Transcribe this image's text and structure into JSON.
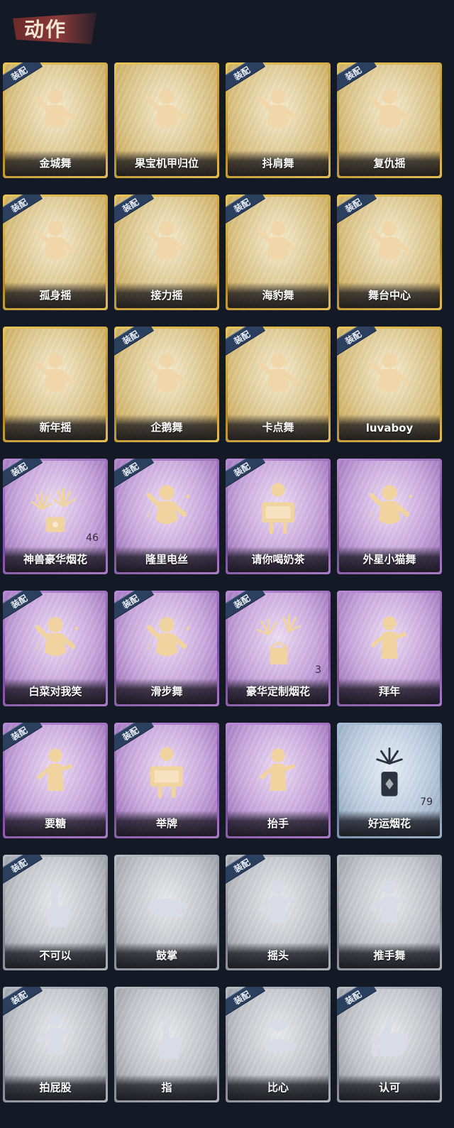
{
  "header": {
    "title": "动作"
  },
  "equip_label": "装配",
  "cards": [
    {
      "name": "金城舞",
      "tier": "gold",
      "equipped": true,
      "icon": "dance-pose-icon"
    },
    {
      "name": "果宝机甲归位",
      "tier": "gold",
      "equipped": false,
      "icon": "dance-pose-icon"
    },
    {
      "name": "抖肩舞",
      "tier": "gold",
      "equipped": true,
      "icon": "dance-pose-icon"
    },
    {
      "name": "复仇摇",
      "tier": "gold",
      "equipped": true,
      "icon": "dance-pose-icon"
    },
    {
      "name": "孤身摇",
      "tier": "gold",
      "equipped": true,
      "icon": "dance-pose-icon"
    },
    {
      "name": "接力摇",
      "tier": "gold",
      "equipped": true,
      "icon": "dance-pose-icon"
    },
    {
      "name": "海豹舞",
      "tier": "gold",
      "equipped": true,
      "icon": "dance-pose-icon"
    },
    {
      "name": "舞台中心",
      "tier": "gold",
      "equipped": true,
      "icon": "dance-pose-icon"
    },
    {
      "name": "新年摇",
      "tier": "gold",
      "equipped": false,
      "icon": "dance-pose-icon"
    },
    {
      "name": "企鹅舞",
      "tier": "gold",
      "equipped": true,
      "icon": "dance-pose-icon"
    },
    {
      "name": "卡点舞",
      "tier": "gold",
      "equipped": true,
      "icon": "dance-pose-icon"
    },
    {
      "name": "luvaboy",
      "tier": "gold",
      "equipped": true,
      "icon": "dance-pose-icon"
    },
    {
      "name": "神兽豪华烟花",
      "tier": "purple",
      "equipped": true,
      "icon": "fireworks-icon",
      "count": "46"
    },
    {
      "name": "隆里电丝",
      "tier": "purple",
      "equipped": true,
      "icon": "dance-pose-icon"
    },
    {
      "name": "请你喝奶茶",
      "tier": "purple",
      "equipped": true,
      "icon": "sign-pose-icon"
    },
    {
      "name": "外星小猫舞",
      "tier": "purple",
      "equipped": false,
      "icon": "dance-pose-icon"
    },
    {
      "name": "白菜对我笑",
      "tier": "purple",
      "equipped": true,
      "icon": "dance-pose-icon"
    },
    {
      "name": "滑步舞",
      "tier": "purple",
      "equipped": true,
      "icon": "dance-pose-icon"
    },
    {
      "name": "豪华定制烟花",
      "tier": "purple",
      "equipped": true,
      "icon": "fireworks-box-icon",
      "count": "3"
    },
    {
      "name": "拜年",
      "tier": "purple",
      "equipped": false,
      "icon": "greeting-pose-icon"
    },
    {
      "name": "要糖",
      "tier": "purple",
      "equipped": true,
      "icon": "greeting-pose-icon"
    },
    {
      "name": "举牌",
      "tier": "purple",
      "equipped": true,
      "icon": "sign-pose-icon"
    },
    {
      "name": "抬手",
      "tier": "purple",
      "equipped": false,
      "icon": "greeting-pose-icon"
    },
    {
      "name": "好运烟花",
      "tier": "blue",
      "equipped": false,
      "icon": "firecracker-icon",
      "count": "79"
    },
    {
      "name": "不可以",
      "tier": "gray",
      "equipped": true,
      "icon": "finger-icon"
    },
    {
      "name": "鼓掌",
      "tier": "gray",
      "equipped": false,
      "icon": "clap-icon"
    },
    {
      "name": "摇头",
      "tier": "gray",
      "equipped": true,
      "icon": "greeting-pose-icon"
    },
    {
      "name": "推手舞",
      "tier": "gray",
      "equipped": false,
      "icon": "greeting-pose-icon"
    },
    {
      "name": "拍屁股",
      "tier": "gray",
      "equipped": true,
      "icon": "greeting-pose-icon"
    },
    {
      "name": "指",
      "tier": "gray",
      "equipped": false,
      "icon": "finger-icon"
    },
    {
      "name": "比心",
      "tier": "gray",
      "equipped": true,
      "icon": "heart-hand-icon"
    },
    {
      "name": "认可",
      "tier": "gray",
      "equipped": true,
      "icon": "thumbs-up-icon"
    }
  ],
  "colors": {
    "background": "#131925",
    "gold": "#d9b24a",
    "purple": "#a57ac4",
    "blue": "#9fb2c8",
    "gray": "#aeb1b8",
    "equip_badge": "#2b3f5e"
  }
}
